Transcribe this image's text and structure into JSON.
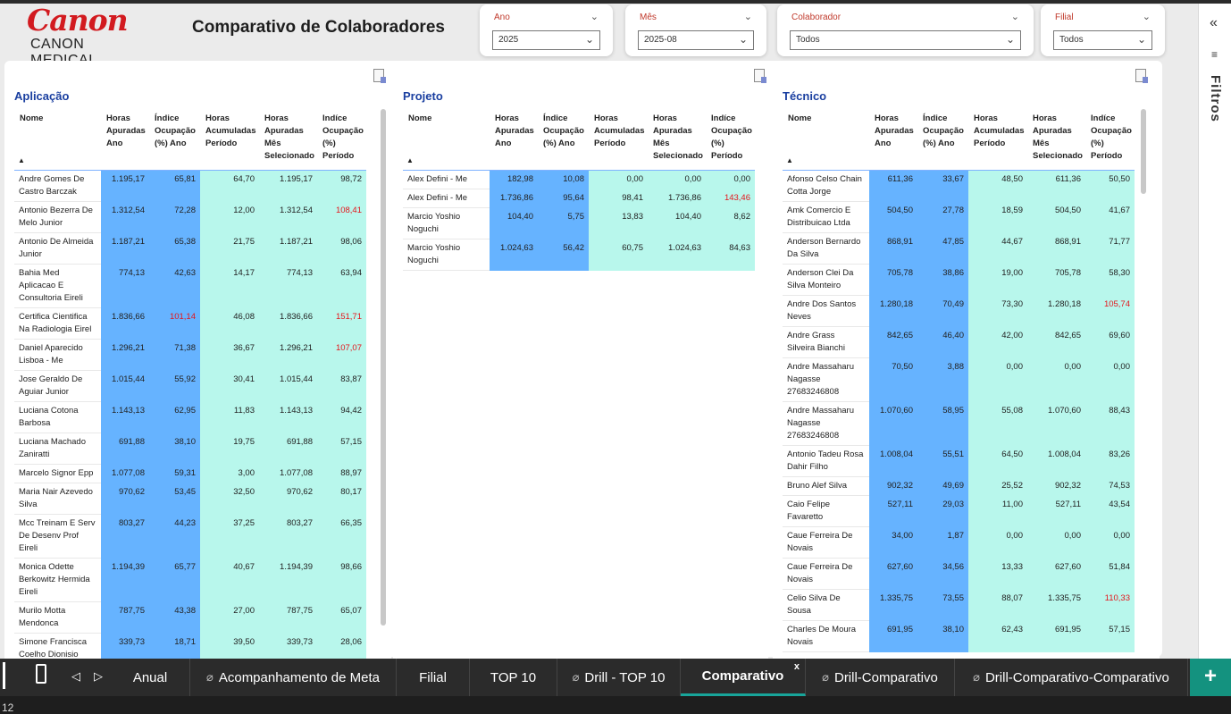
{
  "brand": {
    "logo_word": "Canon",
    "logo_sub": "CANON MEDICAL",
    "red": "#d21a1f"
  },
  "page_title": "Comparativo de Colaboradores",
  "slicers": [
    {
      "label": "Ano",
      "value": "2025"
    },
    {
      "label": "Mês",
      "value": "2025-08"
    },
    {
      "label": "Colaborador",
      "value": "Todos"
    },
    {
      "label": "Filial",
      "value": "Todos"
    }
  ],
  "filter_pane": {
    "title": "Filtros",
    "collapse_icon": "double-chevron-left-icon",
    "filter_icon": "filter-icon"
  },
  "columns": [
    "Nome",
    "Horas Apuradas Ano",
    "Índice Ocupação (%) Ano",
    "Horas Acumuladas Período",
    "Horas Apuradas Mês Selecionado",
    "Indíce Ocupação (%) Período"
  ],
  "colors": {
    "col_blue": "#66b3ff",
    "col_teal": "#b8f7ec",
    "title_blue": "#1a3fa0",
    "alert_red": "#e5141a",
    "tab_active": "#18a59a"
  },
  "panels": [
    {
      "title": "Aplicação",
      "rows": [
        [
          "Andre Gomes De Castro Barczak",
          "1.195,17",
          "65,81",
          "64,70",
          "1.195,17",
          "98,72"
        ],
        [
          "Antonio Bezerra De Melo Junior",
          "1.312,54",
          "72,28",
          "12,00",
          "1.312,54",
          "108,41"
        ],
        [
          "Antonio De Almeida Junior",
          "1.187,21",
          "65,38",
          "21,75",
          "1.187,21",
          "98,06"
        ],
        [
          "Bahia Med Aplicacao E Consultoria Eireli",
          "774,13",
          "42,63",
          "14,17",
          "774,13",
          "63,94"
        ],
        [
          "Certifica Cientifica Na Radiologia Eirel",
          "1.836,66",
          "101,14",
          "46,08",
          "1.836,66",
          "151,71"
        ],
        [
          "Daniel Aparecido Lisboa - Me",
          "1.296,21",
          "71,38",
          "36,67",
          "1.296,21",
          "107,07"
        ],
        [
          "Jose Geraldo De Aguiar Junior",
          "1.015,44",
          "55,92",
          "30,41",
          "1.015,44",
          "83,87"
        ],
        [
          "Luciana Cotona Barbosa",
          "1.143,13",
          "62,95",
          "11,83",
          "1.143,13",
          "94,42"
        ],
        [
          "Luciana Machado Zaniratti",
          "691,88",
          "38,10",
          "19,75",
          "691,88",
          "57,15"
        ],
        [
          "Marcelo Signor Epp",
          "1.077,08",
          "59,31",
          "3,00",
          "1.077,08",
          "88,97"
        ],
        [
          "Maria Nair Azevedo Silva",
          "970,62",
          "53,45",
          "32,50",
          "970,62",
          "80,17"
        ],
        [
          "Mcc Treinam E Serv De Desenv Prof Eireli",
          "803,27",
          "44,23",
          "37,25",
          "803,27",
          "66,35"
        ],
        [
          "Monica Odette Berkowitz Hermida Eireli",
          "1.194,39",
          "65,77",
          "40,67",
          "1.194,39",
          "98,66"
        ],
        [
          "Murilo Motta Mendonca",
          "787,75",
          "43,38",
          "27,00",
          "787,75",
          "65,07"
        ],
        [
          "Simone Francisca Coelho Dionisio",
          "339,73",
          "18,71",
          "39,50",
          "339,73",
          "28,06"
        ]
      ],
      "red_cells": [
        [
          1,
          5
        ],
        [
          4,
          2
        ],
        [
          4,
          5
        ],
        [
          5,
          5
        ]
      ]
    },
    {
      "title": "Projeto",
      "rows": [
        [
          "Alex Defini - Me",
          "182,98",
          "10,08",
          "0,00",
          "0,00",
          "0,00"
        ],
        [
          "Alex Defini - Me",
          "1.736,86",
          "95,64",
          "98,41",
          "1.736,86",
          "143,46"
        ],
        [
          "Marcio Yoshio Noguchi",
          "104,40",
          "5,75",
          "13,83",
          "104,40",
          "8,62"
        ],
        [
          "Marcio Yoshio Noguchi",
          "1.024,63",
          "56,42",
          "60,75",
          "1.024,63",
          "84,63"
        ]
      ],
      "red_cells": [
        [
          1,
          5
        ]
      ]
    },
    {
      "title": "Técnico",
      "rows": [
        [
          "Afonso Celso Chain Cotta Jorge",
          "611,36",
          "33,67",
          "48,50",
          "611,36",
          "50,50"
        ],
        [
          "Amk Comercio E Distribuicao Ltda",
          "504,50",
          "27,78",
          "18,59",
          "504,50",
          "41,67"
        ],
        [
          "Anderson Bernardo Da Silva",
          "868,91",
          "47,85",
          "44,67",
          "868,91",
          "71,77"
        ],
        [
          "Anderson Clei Da Silva Monteiro",
          "705,78",
          "38,86",
          "19,00",
          "705,78",
          "58,30"
        ],
        [
          "Andre Dos Santos Neves",
          "1.280,18",
          "70,49",
          "73,30",
          "1.280,18",
          "105,74"
        ],
        [
          "Andre Grass Silveira Bianchi",
          "842,65",
          "46,40",
          "42,00",
          "842,65",
          "69,60"
        ],
        [
          "Andre Massaharu Nagasse 27683246808",
          "70,50",
          "3,88",
          "0,00",
          "0,00",
          "0,00"
        ],
        [
          "Andre Massaharu Nagasse 27683246808",
          "1.070,60",
          "58,95",
          "55,08",
          "1.070,60",
          "88,43"
        ],
        [
          "Antonio Tadeu Rosa Dahir Filho",
          "1.008,04",
          "55,51",
          "64,50",
          "1.008,04",
          "83,26"
        ],
        [
          "Bruno Alef Silva",
          "902,32",
          "49,69",
          "25,52",
          "902,32",
          "74,53"
        ],
        [
          "Caio Felipe Favaretto",
          "527,11",
          "29,03",
          "11,00",
          "527,11",
          "43,54"
        ],
        [
          "Caue Ferreira De Novais",
          "34,00",
          "1,87",
          "0,00",
          "0,00",
          "0,00"
        ],
        [
          "Caue Ferreira De Novais",
          "627,60",
          "34,56",
          "13,33",
          "627,60",
          "51,84"
        ],
        [
          "Celio Silva De Sousa",
          "1.335,75",
          "73,55",
          "88,07",
          "1.335,75",
          "110,33"
        ],
        [
          "Charles De Moura Novais",
          "691,95",
          "38,10",
          "62,43",
          "691,95",
          "57,15"
        ]
      ],
      "red_cells": [
        [
          4,
          5
        ],
        [
          13,
          5
        ]
      ]
    }
  ],
  "tabs": [
    {
      "label": "Anual",
      "hidden": false
    },
    {
      "label": "Acompanhamento de Meta",
      "hidden": true
    },
    {
      "label": "Filial",
      "hidden": false
    },
    {
      "label": "TOP 10",
      "hidden": false
    },
    {
      "label": "Drill - TOP 10",
      "hidden": true
    },
    {
      "label": "Comparativo",
      "hidden": false,
      "active": true
    },
    {
      "label": "Drill-Comparativo",
      "hidden": true
    },
    {
      "label": "Drill-Comparativo-Comparativo",
      "hidden": true
    }
  ],
  "tab_close_label": "x",
  "add_tab_label": "+",
  "status": {
    "page_number": "12"
  }
}
